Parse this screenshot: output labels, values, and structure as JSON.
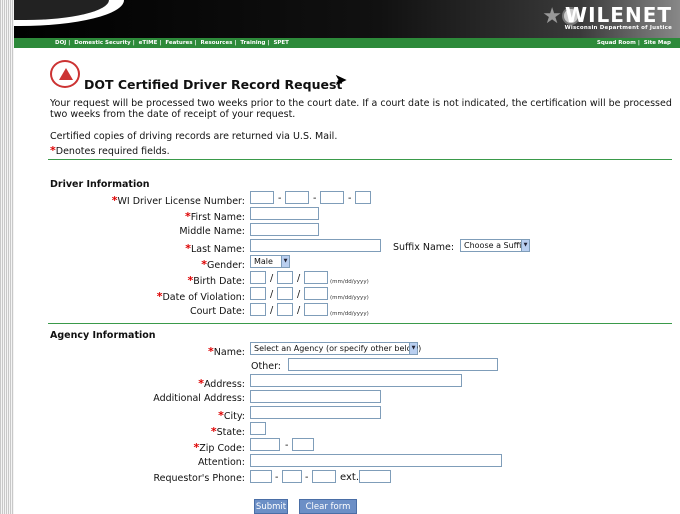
{
  "header": {
    "logo_name": "WILENET",
    "logo_sub": "Wisconsin Department of Justice"
  },
  "nav": {
    "left": [
      "DOJ",
      "Domestic Security",
      "eTIME",
      "Features",
      "Resources",
      "Training",
      "SPET"
    ],
    "right": [
      "Squad Room",
      "Site Map"
    ],
    "separator": "|"
  },
  "page": {
    "title": "DOT Certified Driver Record Request",
    "intro": "Your request will be processed two weeks prior to the court date. If a court date is not indicated, the certification will be processed two weeks from the date of receipt of your request.",
    "mail_note": "Certified copies of driving records are returned via U.S. Mail.",
    "required_note": "Denotes required fields.",
    "required_mark": "*"
  },
  "driver": {
    "heading": "Driver Information",
    "license_label": "WI Driver License Number:",
    "first_label": "First Name:",
    "middle_label": "Middle Name:",
    "last_label": "Last Name:",
    "suffix_label": "Suffix Name:",
    "suffix_value": "Choose a Suffix",
    "gender_label": "Gender:",
    "gender_value": "Male",
    "birth_label": "Birth Date:",
    "violation_label": "Date of Violation:",
    "court_label": "Court Date:",
    "date_hint": "(mm/dd/yyyy)",
    "slash": "/",
    "dash": "-"
  },
  "agency": {
    "heading": "Agency Information",
    "name_label": "Name:",
    "name_value": "Select an Agency (or specify other below)",
    "other_label": "Other:",
    "address_label": "Address:",
    "address2_label": "Additional Address:",
    "city_label": "City:",
    "state_label": "State:",
    "zip_label": "Zip Code:",
    "attention_label": "Attention:",
    "phone_label": "Requestor's Phone:",
    "ext_label": "ext."
  },
  "buttons": {
    "submit": "Submit",
    "clear": "Clear form"
  },
  "colors": {
    "nav_green": "#2d8a3a",
    "required_red": "#dd0000",
    "button_blue": "#6c8fc6"
  }
}
